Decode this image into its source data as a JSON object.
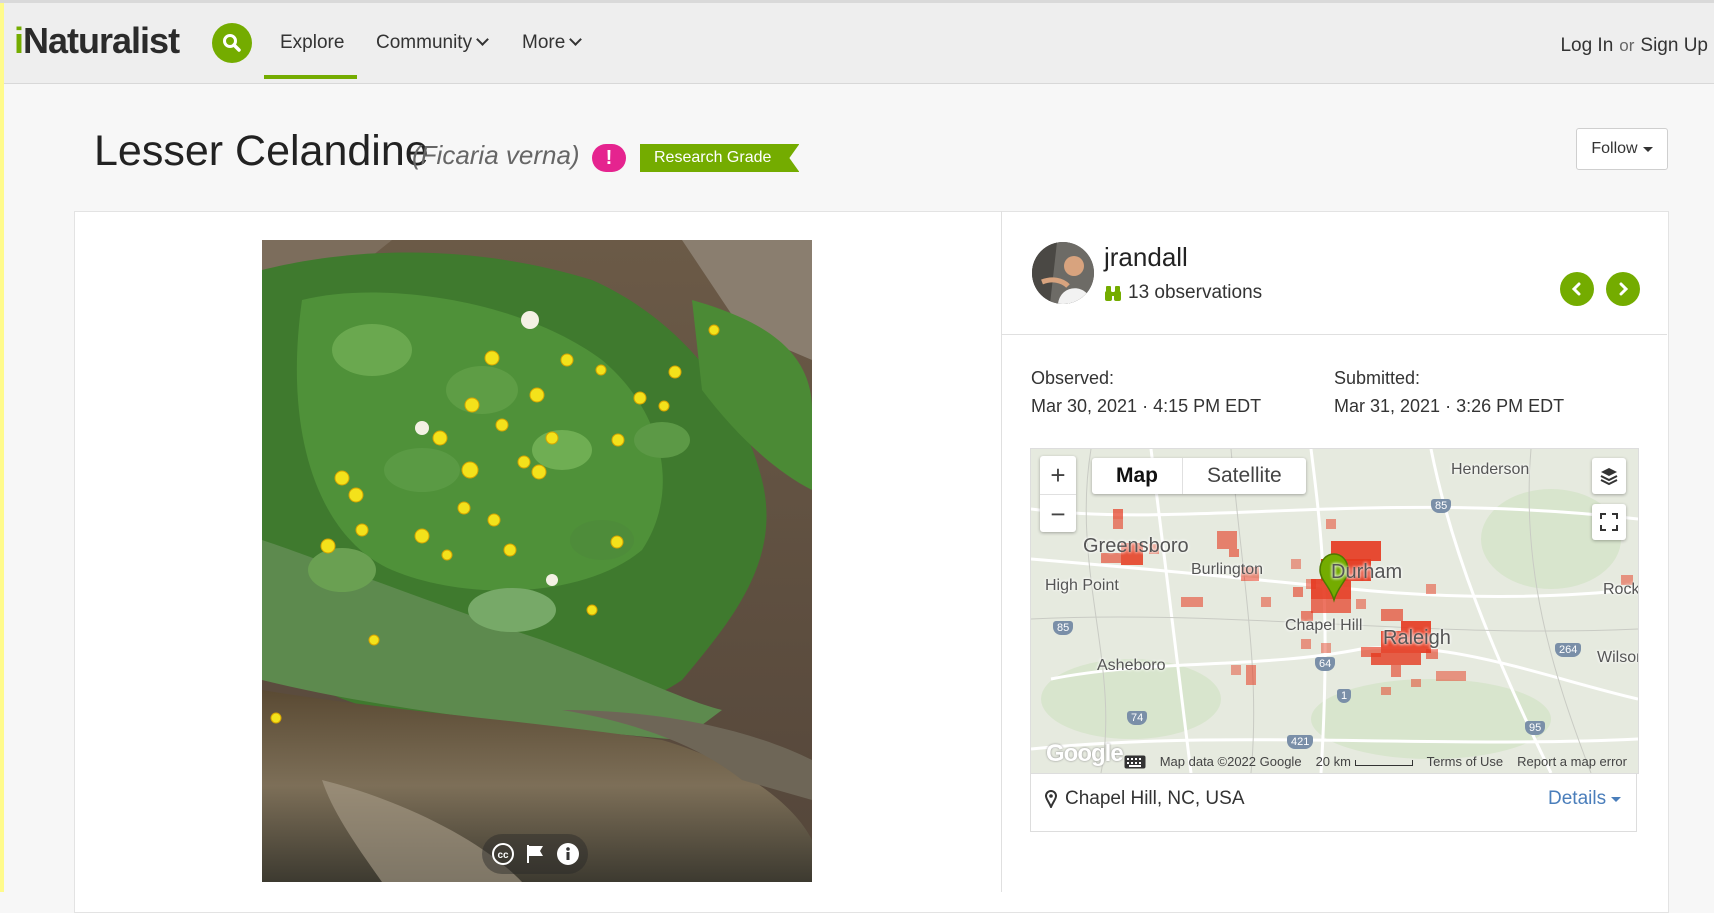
{
  "header": {
    "logo_i": "i",
    "logo_rest": "Naturalist",
    "nav": {
      "explore": "Explore",
      "community": "Community",
      "more": "More"
    },
    "login": "Log In",
    "or": "or",
    "signup": "Sign Up"
  },
  "observation": {
    "common_name": "Lesser Celandine",
    "scientific_name": "(Ficaria verna)",
    "alert_badge": "!",
    "quality_grade": "Research Grade",
    "follow_label": "Follow"
  },
  "observer": {
    "username": "jrandall",
    "observations_count": "13 observations"
  },
  "dates": {
    "observed_label": "Observed:",
    "observed_value": "Mar 30, 2021 · 4:15 PM EDT",
    "submitted_label": "Submitted:",
    "submitted_value": "Mar 31, 2021 · 3:26 PM EDT"
  },
  "map": {
    "zoom_in": "+",
    "zoom_out": "−",
    "type_map": "Map",
    "type_satellite": "Satellite",
    "google": "Google",
    "map_data": "Map data ©2022 Google",
    "scale": "20 km",
    "terms": "Terms of Use",
    "report": "Report a map error",
    "places": [
      "Henderson",
      "Greensboro",
      "Burlington",
      "High Point",
      "Durham",
      "Chapel Hill",
      "Raleigh",
      "Asheboro",
      "Rocky Mount",
      "Wilson"
    ],
    "highways": [
      "85",
      "85",
      "64",
      "1",
      "74",
      "421",
      "264",
      "95"
    ]
  },
  "location": {
    "place": "Chapel Hill, NC, USA",
    "details": "Details"
  },
  "colors": {
    "brand_green": "#74ac00",
    "alert_pink": "#e5248f",
    "link_blue": "#4a7ebb",
    "heat_red": "#e5391f"
  }
}
